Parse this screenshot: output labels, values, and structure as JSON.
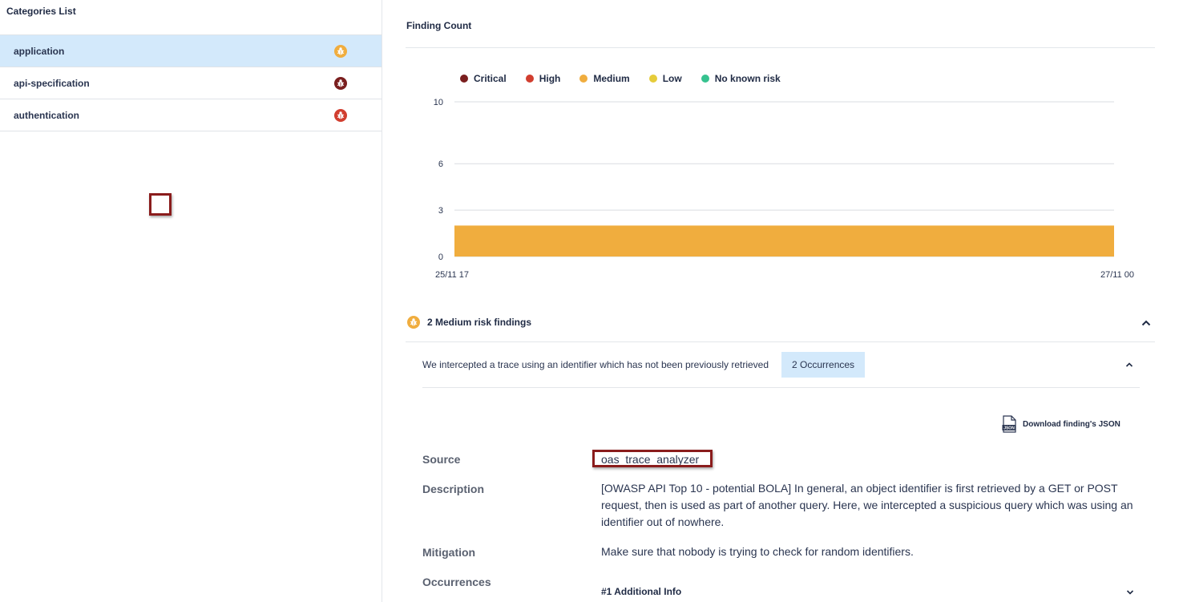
{
  "sidebar": {
    "title": "Categories List",
    "items": [
      {
        "label": "application",
        "risk": "medium",
        "icon": "bug-icon",
        "color": "#f0ad3e"
      },
      {
        "label": "api-specification",
        "risk": "critical",
        "icon": "bug-icon",
        "color": "#7a1e1e"
      },
      {
        "label": "authentication",
        "risk": "high",
        "icon": "bug-icon",
        "color": "#d13e2f"
      }
    ]
  },
  "main": {
    "section_title": "Finding Count",
    "legend": [
      {
        "label": "Critical",
        "color": "#7a1e1e"
      },
      {
        "label": "High",
        "color": "#d13e2f"
      },
      {
        "label": "Medium",
        "color": "#f0ad3e"
      },
      {
        "label": "Low",
        "color": "#e6cc3a"
      },
      {
        "label": "No known risk",
        "color": "#36c28f"
      }
    ],
    "findings": {
      "header": "2 Medium risk findings",
      "finding_title": "We intercepted a trace using an identifier which has not been previously retrieved",
      "occurrences_badge": "2 Occurrences",
      "download_label": "Download finding's JSON",
      "details": {
        "source_label": "Source",
        "source_value": "oas_trace_analyzer",
        "description_label": "Description",
        "description_value": "[OWASP API Top 10 - potential BOLA] In general, an object identifier is first retrieved by a GET or POST request, then is used as part of another query. Here, we intercepted a suspicious query which was using an identifier out of nowhere.",
        "mitigation_label": "Mitigation",
        "mitigation_value": "Make sure that nobody is trying to check for random identifiers.",
        "occurrences_label": "Occurrences",
        "additional_info": "#1 Additional Info"
      }
    }
  },
  "chart_data": {
    "type": "area",
    "x": [
      "25/11 17",
      "27/11 00"
    ],
    "series": [
      {
        "name": "Critical",
        "values": [
          0,
          0
        ]
      },
      {
        "name": "High",
        "values": [
          0,
          0
        ]
      },
      {
        "name": "Medium",
        "values": [
          2,
          2
        ]
      },
      {
        "name": "Low",
        "values": [
          0,
          0
        ]
      },
      {
        "name": "No known risk",
        "values": [
          0,
          0
        ]
      }
    ],
    "yticks": [
      "10",
      "6",
      "3",
      "0"
    ],
    "ytick_values": [
      10,
      6,
      3,
      0
    ],
    "xtick_labels": [
      "25/11 17",
      "27/11 00"
    ],
    "ylim": [
      0,
      10
    ],
    "grid": true,
    "legend_position": "top-left",
    "title": "",
    "xlabel": "",
    "ylabel": ""
  }
}
